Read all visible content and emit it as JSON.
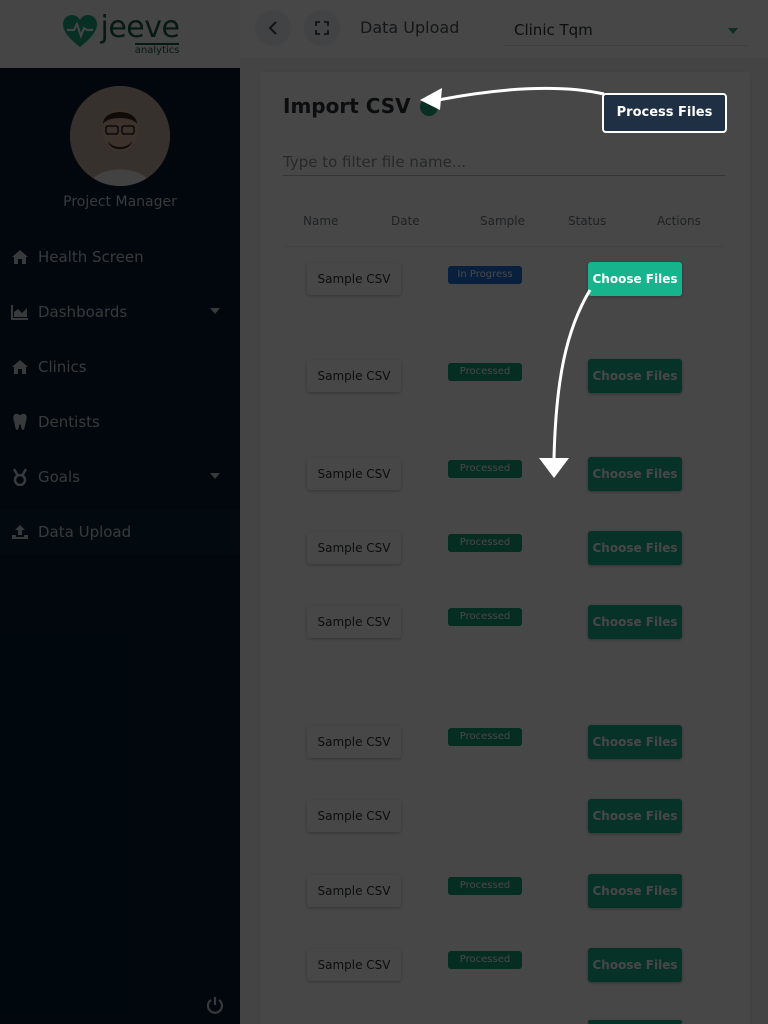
{
  "logo": {
    "name": "jeeve",
    "sub": "analytics"
  },
  "user": {
    "role": "Project Manager"
  },
  "nav": [
    {
      "label": "Health Screen",
      "icon": "home-icon"
    },
    {
      "label": "Dashboards",
      "icon": "chart-icon",
      "has_submenu": true
    },
    {
      "label": "Clinics",
      "icon": "home-icon"
    },
    {
      "label": "Dentists",
      "icon": "tooth-icon"
    },
    {
      "label": "Goals",
      "icon": "medal-icon",
      "has_submenu": true
    },
    {
      "label": "Data Upload",
      "icon": "upload-icon",
      "active": true
    }
  ],
  "topbar": {
    "title": "Data Upload",
    "clinic": "Clinic Tqm"
  },
  "card": {
    "title": "Import CSV",
    "filter_placeholder": "Type to filter file name...",
    "process_label": "Process Files",
    "columns": [
      "Name",
      "Date",
      "Sample",
      "Status",
      "Actions"
    ]
  },
  "rows": [
    {
      "sample": "Sample CSV",
      "status": "In Progress",
      "action": "Choose Files"
    },
    {
      "sample": "Sample CSV",
      "status": "Processed",
      "action": "Choose Files"
    },
    {
      "sample": "Sample CSV",
      "status": "Processed",
      "action": "Choose Files"
    },
    {
      "sample": "Sample CSV",
      "status": "Processed",
      "action": "Choose Files"
    },
    {
      "sample": "Sample CSV",
      "status": "Processed",
      "action": "Choose Files"
    },
    {
      "sample": "Sample CSV",
      "status": "Processed",
      "action": "Choose Files"
    },
    {
      "sample": "Sample CSV",
      "status": "",
      "action": "Choose Files"
    },
    {
      "sample": "Sample CSV",
      "status": "Processed",
      "action": "Choose Files"
    },
    {
      "sample": "Sample CSV",
      "status": "Processed",
      "action": "Choose Files"
    }
  ],
  "colors": {
    "sidebar": "#051c2f",
    "accent": "#16b38c",
    "progress": "#1e6fd9",
    "processed": "#17a277",
    "brand": "#1c5c47"
  }
}
